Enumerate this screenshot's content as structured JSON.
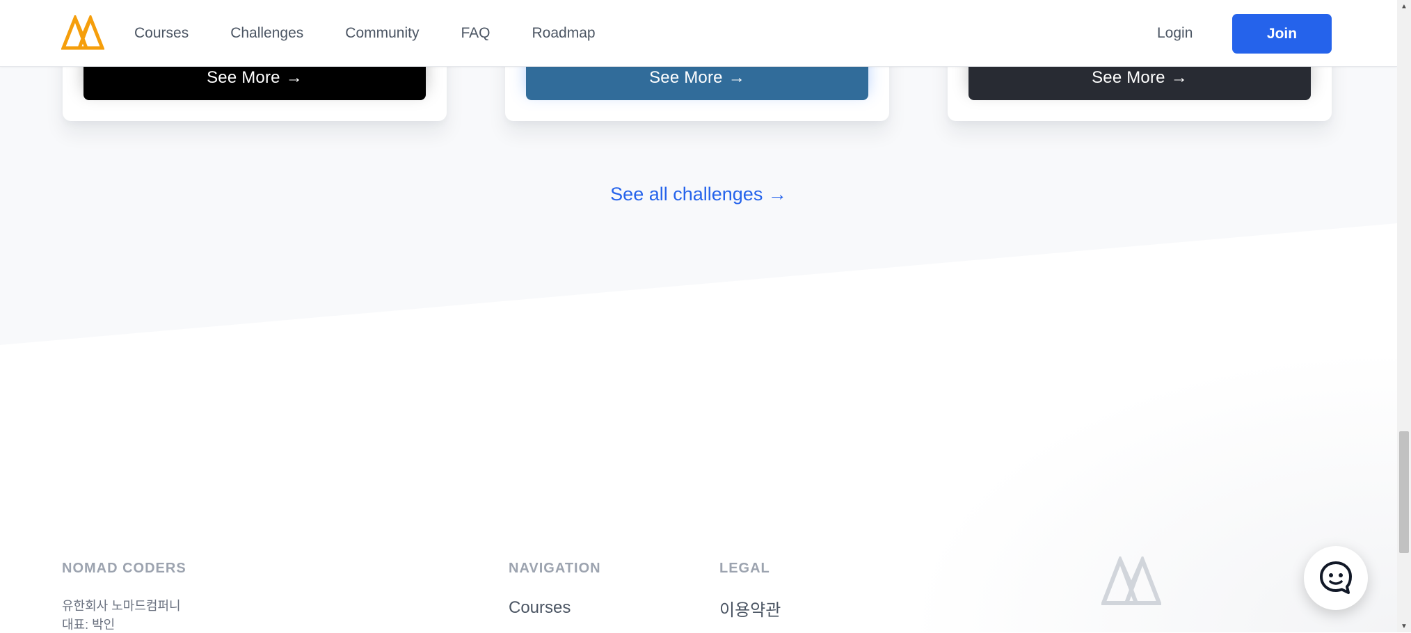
{
  "header": {
    "nav": [
      "Courses",
      "Challenges",
      "Community",
      "FAQ",
      "Roadmap"
    ],
    "login": "Login",
    "join": "Join"
  },
  "cards": [
    {
      "label": "See More",
      "arrow": "→",
      "color": "#000000"
    },
    {
      "label": "See More",
      "arrow": "→",
      "color": "#316c9a"
    },
    {
      "label": "See More",
      "arrow": "→",
      "color": "#282b33"
    }
  ],
  "see_all": "See all challenges →",
  "footer": {
    "company_title": "NOMAD CODERS",
    "company_line1": "유한회사 노마드컴퍼니",
    "company_line2": "대표: 박인",
    "navigation_title": "NAVIGATION",
    "navigation_items": [
      "Courses"
    ],
    "legal_title": "LEGAL",
    "legal_items": [
      "이용약관"
    ]
  },
  "icons": {
    "logo": "nomad-coders-logo",
    "chat": "chat-bubble-icon"
  },
  "colors": {
    "accent": "#2563eb",
    "logo": "#f59e0b"
  }
}
